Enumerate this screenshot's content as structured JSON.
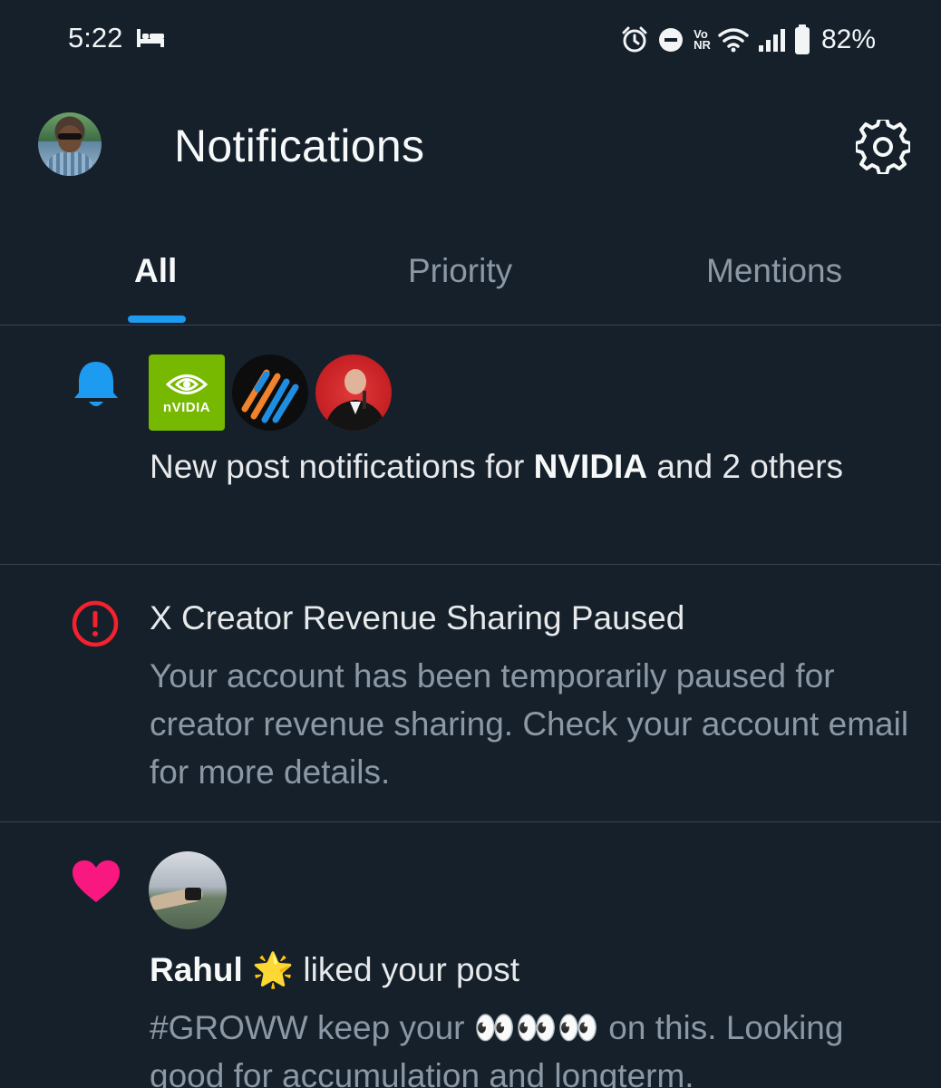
{
  "status_bar": {
    "time": "5:22",
    "network_label_top": "Vo",
    "network_label_bottom": "NR",
    "battery": "82%",
    "icons": [
      "bed-icon",
      "alarm-icon",
      "do-not-disturb-icon",
      "vonr-icon",
      "wifi-icon",
      "signal-icon",
      "battery-icon"
    ]
  },
  "header": {
    "title": "Notifications",
    "settings_icon": "gear-icon"
  },
  "tabs": [
    {
      "label": "All",
      "active": true
    },
    {
      "label": "Priority",
      "active": false
    },
    {
      "label": "Mentions",
      "active": false
    }
  ],
  "colors": {
    "background": "#15202b",
    "accent": "#1d9bf0",
    "alert": "#f4212e",
    "like": "#f91880",
    "nvidia_green": "#76b900"
  },
  "notifications": [
    {
      "type": "new-post",
      "icon": "bell-icon",
      "avatar_logo_text": "nVIDIA",
      "text_pre": "New post notifications for ",
      "text_bold": "NVIDIA",
      "text_post": " and 2 others"
    },
    {
      "type": "alert",
      "icon": "alert-circle-icon",
      "title": "X Creator Revenue Sharing Paused",
      "body": "Your account has been temporarily paused for creator revenue sharing. Check your account email for more details."
    },
    {
      "type": "like",
      "icon": "heart-icon",
      "user": "Rahul",
      "user_emoji": "🌟",
      "action": " liked your post",
      "post_pre": "#GROWW keep your  ",
      "post_emoji": "👀👀👀",
      "post_post": " on this. Looking good for accumulation and longterm."
    }
  ]
}
